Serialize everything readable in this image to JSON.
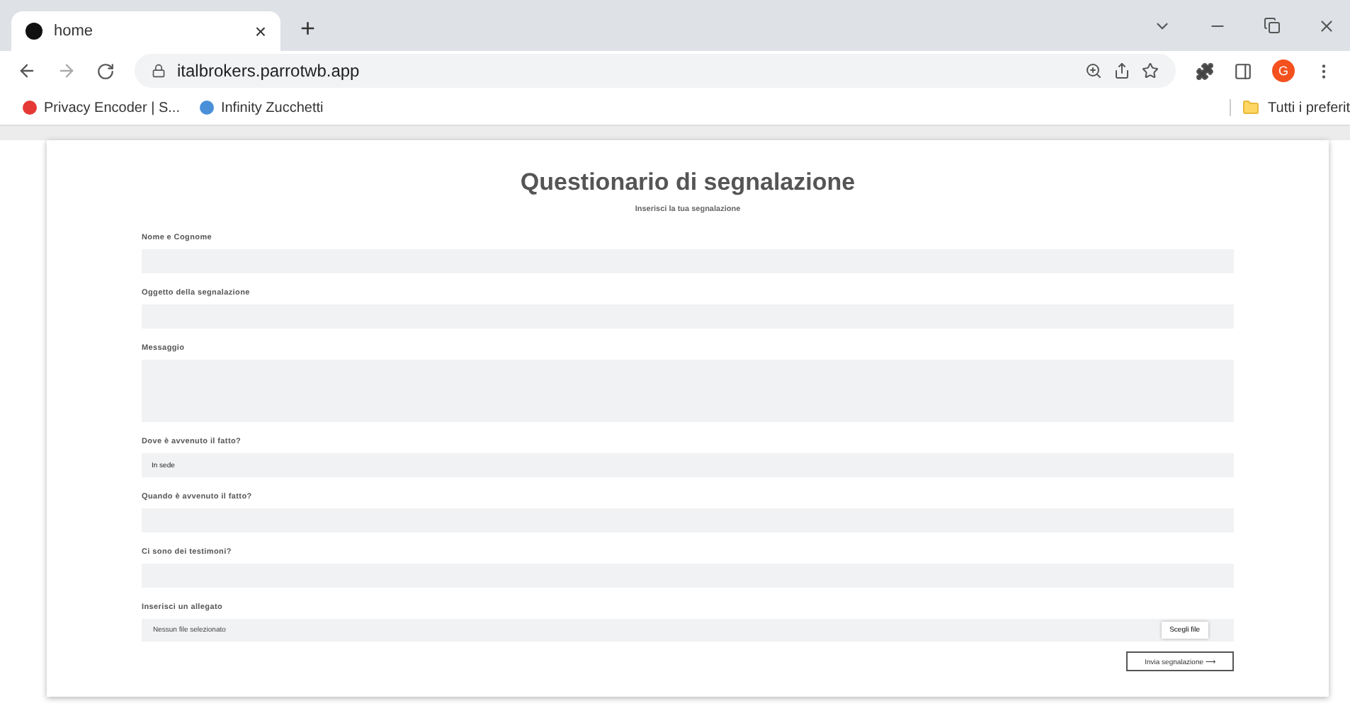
{
  "browser": {
    "tab": {
      "title": "home",
      "close": "×",
      "selected": true
    },
    "new_tab": "+",
    "address": "italbrokers.parrotwb.app",
    "profile": "G",
    "bookmarks": [
      {
        "label": "Privacy Encoder | S...",
        "color": "#e53935"
      },
      {
        "label": "Infinity Zucchetti",
        "color": "#4a90d9"
      }
    ],
    "all_bookmarks": "Tutti i preferit"
  },
  "form": {
    "title": "Questionario di segnalazione",
    "subtitle": "Inserisci la tua segnalazione",
    "fields": [
      {
        "kind": "text",
        "label": "Nome e Cognome"
      },
      {
        "kind": "text",
        "label": "Oggetto della segnalazione"
      },
      {
        "kind": "textarea",
        "label": "Messaggio"
      },
      {
        "kind": "text",
        "label": "Dove è avvenuto il fatto?",
        "value": "In sede"
      },
      {
        "kind": "text",
        "label": "Quando è avvenuto il fatto?"
      },
      {
        "kind": "text",
        "label": "Ci sono dei testimoni?"
      },
      {
        "kind": "file",
        "label": "Inserisci un allegato",
        "value": "Nessun file selezionato",
        "button": "Scegli file"
      }
    ],
    "submit": "Invia segnalazione ⟶"
  }
}
